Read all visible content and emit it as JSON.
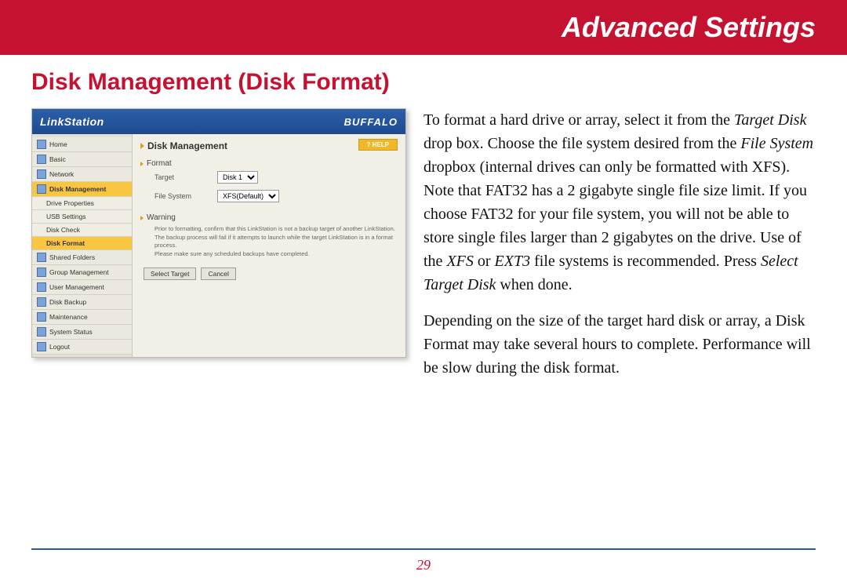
{
  "banner": {
    "title": "Advanced Settings"
  },
  "heading": "Disk Management (Disk Format)",
  "screenshot": {
    "logo": "LinkStation",
    "brand": "BUFFALO",
    "main_title": "Disk Management",
    "help_label": "? HELP",
    "nav": [
      {
        "label": "Home",
        "sel": false,
        "sub": false
      },
      {
        "label": "Basic",
        "sel": false,
        "sub": false
      },
      {
        "label": "Network",
        "sel": false,
        "sub": false
      },
      {
        "label": "Disk Management",
        "sel": true,
        "sub": false
      },
      {
        "label": "Drive Properties",
        "sel": false,
        "sub": true
      },
      {
        "label": "USB Settings",
        "sel": false,
        "sub": true
      },
      {
        "label": "Disk Check",
        "sel": false,
        "sub": true
      },
      {
        "label": "Disk Format",
        "sel": true,
        "sub": true
      },
      {
        "label": "Shared Folders",
        "sel": false,
        "sub": false
      },
      {
        "label": "Group Management",
        "sel": false,
        "sub": false
      },
      {
        "label": "User Management",
        "sel": false,
        "sub": false
      },
      {
        "label": "Disk Backup",
        "sel": false,
        "sub": false
      },
      {
        "label": "Maintenance",
        "sel": false,
        "sub": false
      },
      {
        "label": "System Status",
        "sel": false,
        "sub": false
      },
      {
        "label": "Logout",
        "sel": false,
        "sub": false
      }
    ],
    "sections": {
      "format_label": "Format",
      "target_label": "Target",
      "target_value": "Disk 1",
      "fs_label": "File System",
      "fs_value": "XFS(Default)",
      "warning_label": "Warning",
      "warning_text_1": "Prior to formatting, confirm that this LinkStation is not a backup target of another LinkStation.",
      "warning_text_2": "The backup process will fail if it attempts to launch while the target LinkStation is in a format process.",
      "warning_text_3": "Please make sure any scheduled backups have completed."
    },
    "buttons": {
      "select": "Select Target",
      "cancel": "Cancel"
    }
  },
  "body": {
    "p1_a": "To format a hard drive or array, select it from the ",
    "p1_i1": "Target Disk",
    "p1_b": " drop box.  Choose the file system desired from the ",
    "p1_i2": "File System",
    "p1_c": " dropbox (internal drives can only be formatted with XFS).  Note that FAT32 has a 2 gigabyte single file size limit.  If you choose FAT32 for your file system, you will not be able to store single files larger than 2 gigabytes on the drive.  Use of the ",
    "p1_i3": "XFS",
    "p1_d": " or ",
    "p1_i4": "EXT3",
    "p1_e": " file systems is recommended.  Press ",
    "p1_i5": "Select Target Disk",
    "p1_f": " when done.",
    "p2": "Depending on the size of the target hard disk or array, a Disk Format may take several hours to complete.  Performance will be slow during the disk format."
  },
  "page_number": "29"
}
